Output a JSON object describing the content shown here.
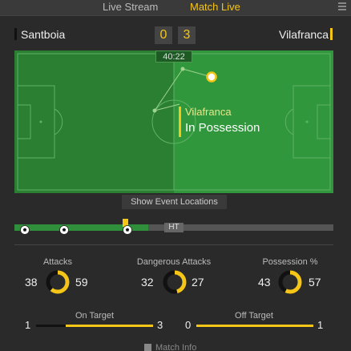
{
  "tabs": {
    "live_stream": "Live Stream",
    "match_live": "Match Live"
  },
  "score": {
    "home_team": "Santboia",
    "away_team": "Vilafranca",
    "home_score": "0",
    "away_score": "3",
    "home_color": "#111111",
    "away_color": "#f5c518"
  },
  "pitch": {
    "clock": "40:22",
    "possession_team": "Vilafranca",
    "possession_label": "In Possession"
  },
  "show_events_label": "Show Event Locations",
  "timeline": {
    "ht_label": "HT",
    "progress_fraction": 0.42
  },
  "stats": {
    "attacks": {
      "label": "Attacks",
      "home": "38",
      "away": "59"
    },
    "dangerous_attacks": {
      "label": "Dangerous Attacks",
      "home": "32",
      "away": "27"
    },
    "possession": {
      "label": "Possession %",
      "home": "43",
      "away": "57"
    }
  },
  "bars": {
    "on_target": {
      "label": "On Target",
      "home": "1",
      "away": "3"
    },
    "off_target": {
      "label": "Off Target",
      "home": "0",
      "away": "1"
    }
  },
  "match_info_label": "Match Info",
  "icons": {
    "menu": "menu-icon",
    "ball": "football-icon",
    "info": "info-icon"
  }
}
